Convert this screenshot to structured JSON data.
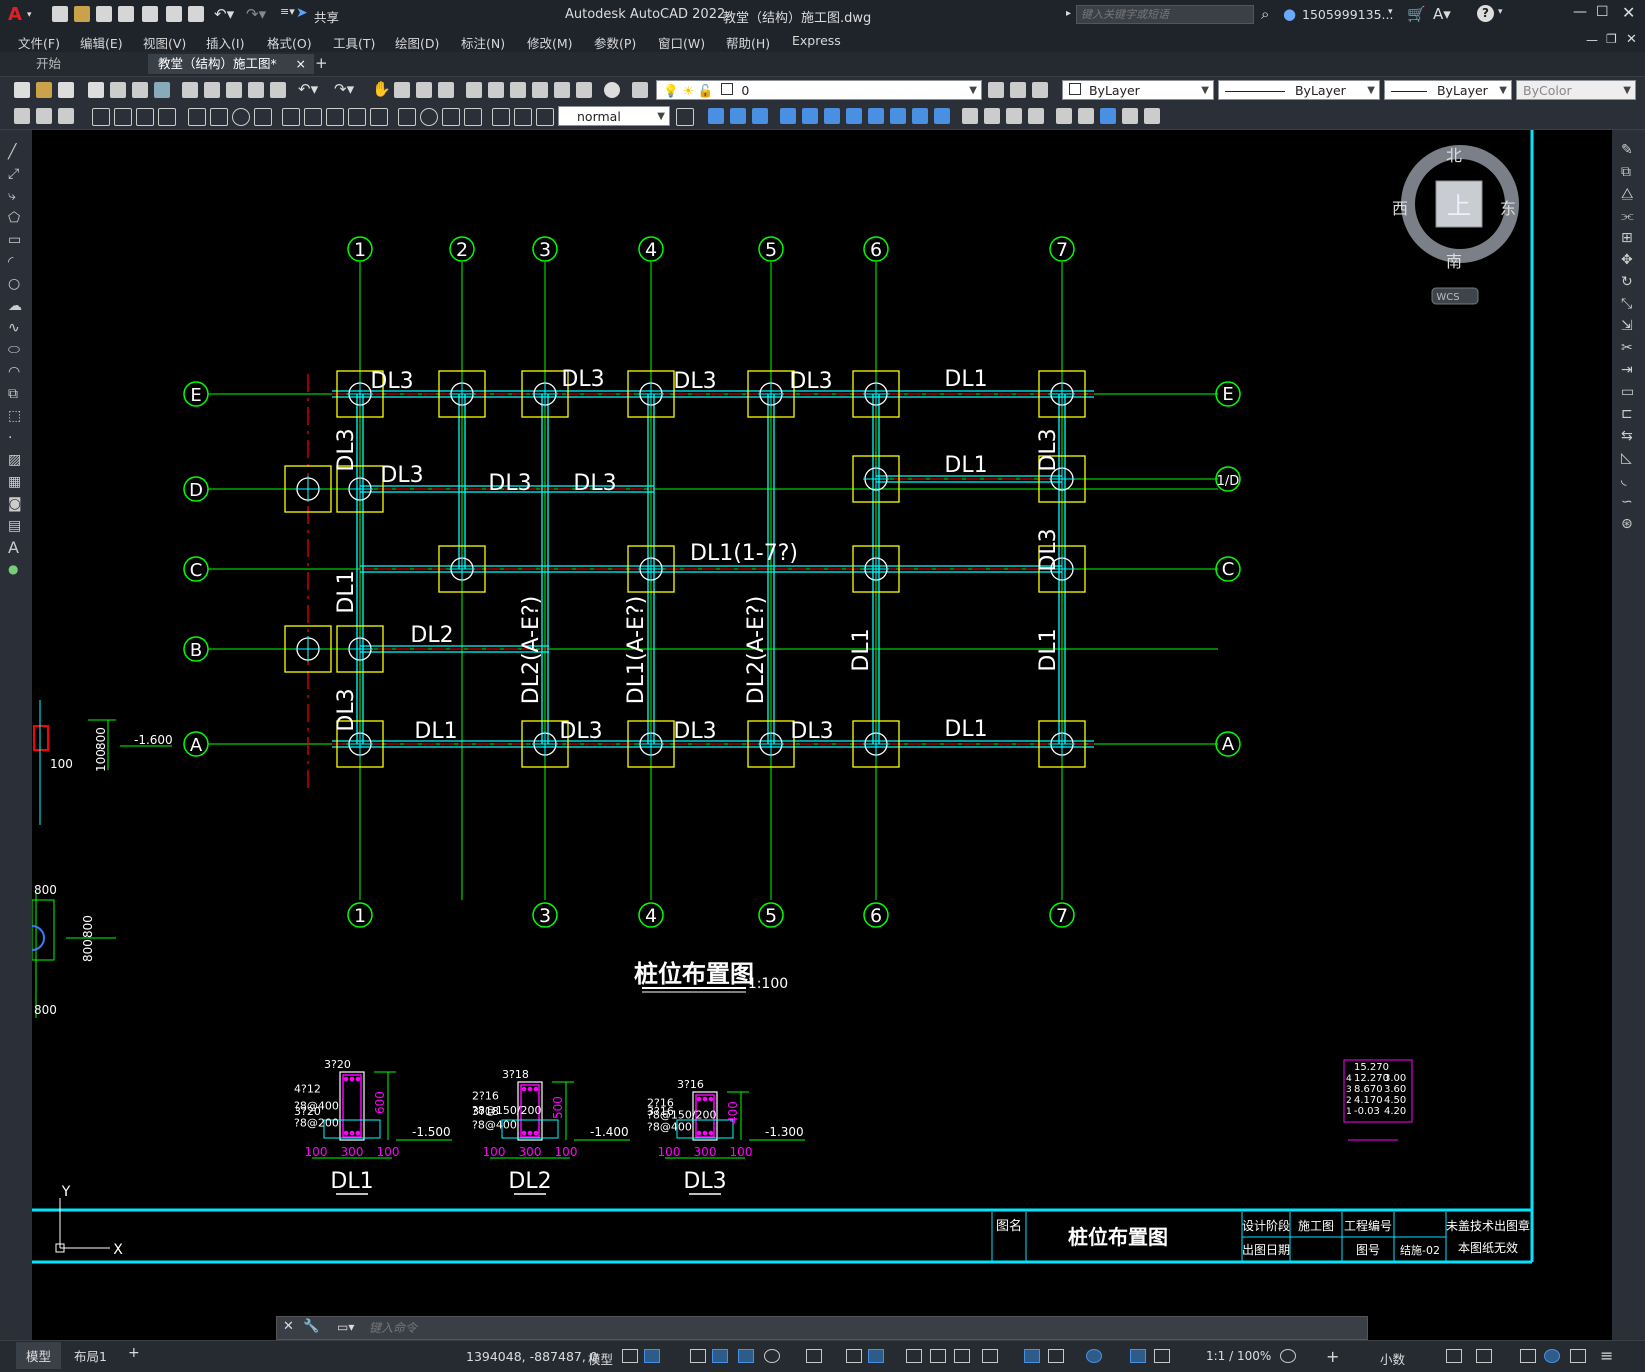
{
  "app": {
    "logo": "A",
    "title": "Autodesk AutoCAD 2022",
    "filename": "教堂（结构）施工图.dwg",
    "share_label": "共享",
    "search_placeholder": "键入关键字或短语",
    "user": "1505999135...",
    "help": "?"
  },
  "menu": [
    "文件(F)",
    "编辑(E)",
    "视图(V)",
    "插入(I)",
    "格式(O)",
    "工具(T)",
    "绘图(D)",
    "标注(N)",
    "修改(M)",
    "参数(P)",
    "窗口(W)",
    "帮助(H)",
    "Express"
  ],
  "tabs": {
    "start": "开始",
    "doc": "教堂（结构）施工图*",
    "close": "×",
    "add": "+"
  },
  "toolbar": {
    "layer_value": "0",
    "color_value": "ByLayer",
    "linetype_value": "ByLayer",
    "lineweight_value": "ByLayer",
    "plotstyle_value": "ByColor",
    "dimstyle_value": "normal"
  },
  "viewcube": {
    "north": "北",
    "south": "南",
    "east": "东",
    "west": "西",
    "face": "上",
    "wcs": "WCS"
  },
  "colors": {
    "grid": "#00ff00",
    "beam": "#00ffff",
    "cap": "#ffff00",
    "center": "#ff0000",
    "text": "#ffffff",
    "magenta": "#ff00ff",
    "border": "#00e5ff"
  },
  "drawing": {
    "col_labels": [
      "1",
      "2",
      "3",
      "4",
      "5",
      "6",
      "7"
    ],
    "bottom_col_labels": [
      "1",
      "3",
      "4",
      "5",
      "6",
      "7"
    ],
    "row_labels": [
      "E",
      "D",
      "C",
      "B",
      "A"
    ],
    "right_row_labels": [
      "E",
      "1/D",
      "C",
      "A"
    ],
    "beam_labels": [
      "DL3",
      "DL3",
      "DL3",
      "DL3",
      "DL1",
      "DL3",
      "DL3",
      "DL3",
      "DL1",
      "DL1(1-7?)",
      "DL2",
      "DL1",
      "DL3",
      "DL3",
      "DL3",
      "DL1"
    ],
    "vertical_beam_labels": [
      "DL3",
      "DL1",
      "DL3",
      "DL2(A-E?)",
      "DL1(A-E?)",
      "DL2(A-E?)",
      "DL1",
      "DL3",
      "DL3",
      "DL1"
    ],
    "left_dims": [
      "800",
      "100",
      "-1.600",
      "100",
      "800",
      "800",
      "800",
      "800"
    ],
    "plan_title": "桩位布置图",
    "plan_scale": "1:100",
    "sections": [
      {
        "name": "DL1",
        "height": "600",
        "level": "-1.500",
        "top_bar": "3?20",
        "side_bars": "4?12",
        "stirrup1": "?8@400",
        "stirrup2": "?8@200",
        "bottom_bar": "3?20",
        "dims": [
          "100",
          "300",
          "100"
        ]
      },
      {
        "name": "DL2",
        "height": "500",
        "level": "-1.400",
        "top_bar": "3?18",
        "side_bars": "2?16",
        "stirrup1": "?8@150/200",
        "stirrup2": "?8@400",
        "bottom_bar": "3?18",
        "dims": [
          "100",
          "300",
          "100"
        ]
      },
      {
        "name": "DL3",
        "height": "400",
        "level": "-1.300",
        "top_bar": "3?16",
        "side_bars": "2?16",
        "stirrup1": "?8@150/200",
        "stirrup2": "?8@400",
        "bottom_bar": "3?16",
        "dims": [
          "100",
          "300",
          "100"
        ]
      }
    ],
    "level_table": {
      "rows": [
        "15.270",
        "12.270",
        "8.670",
        "4.170",
        "-0.03"
      ],
      "heights": [
        "3.00",
        "3.60",
        "4.50",
        "4.20"
      ],
      "labels": [
        "4",
        "3",
        "2",
        "1"
      ]
    }
  },
  "titleblock": {
    "drawing_name_label": "图名",
    "drawing_name": "桩位布置图",
    "stage_label": "设计阶段",
    "stage_value": "施工图",
    "project_no_label": "工程编号",
    "sheet_label": "图号",
    "sheet_value": "结施-02",
    "stamp_line1": "未盖技术出图章",
    "stamp_line2": "本图纸无效",
    "date_label": "出图日期"
  },
  "ucs": {
    "x": "X",
    "y": "Y"
  },
  "command": {
    "placeholder": "键入命令"
  },
  "status": {
    "tabs": [
      "模型",
      "布局1",
      "+"
    ],
    "coords": "1394048, -887487, 0",
    "space": "模型",
    "scale": "1:1 / 100%",
    "units": "小数"
  }
}
